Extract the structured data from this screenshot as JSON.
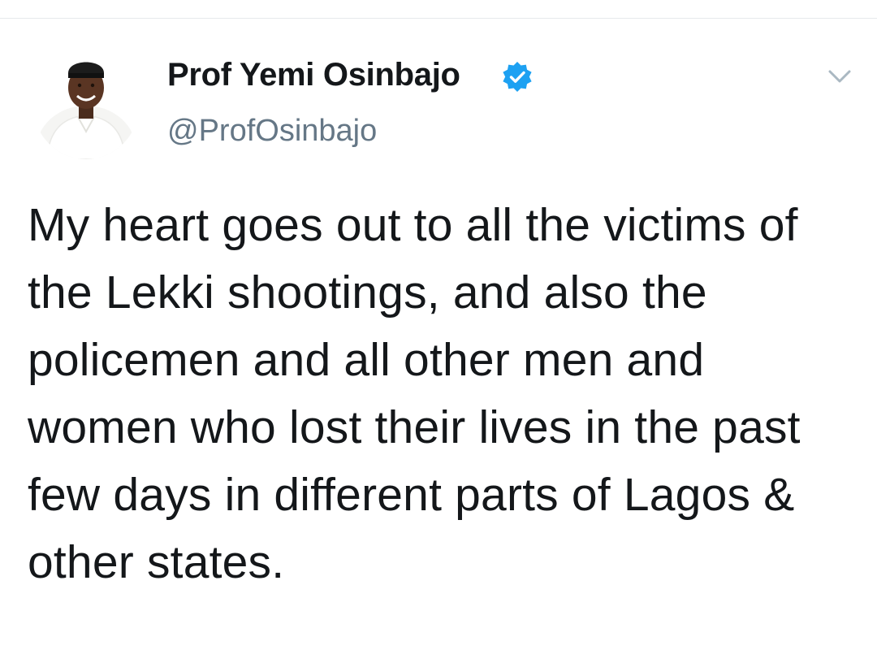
{
  "tweet": {
    "author": {
      "display_name": "Prof Yemi Osinbajo",
      "handle": "@ProfOsinbajo",
      "verified": true,
      "avatar": "profile-photo"
    },
    "text": "My heart goes out to all the victims of the Lekki shootings, and also the  policemen and all other men and women who lost their lives in the past few days in different parts of Lagos & other states.",
    "menu_icon": "chevron-down-icon"
  },
  "colors": {
    "text_primary": "#14171a",
    "text_secondary": "#657786",
    "verified_blue": "#1da1f2",
    "divider": "#e6e9ec",
    "chevron": "#aab8c2"
  }
}
